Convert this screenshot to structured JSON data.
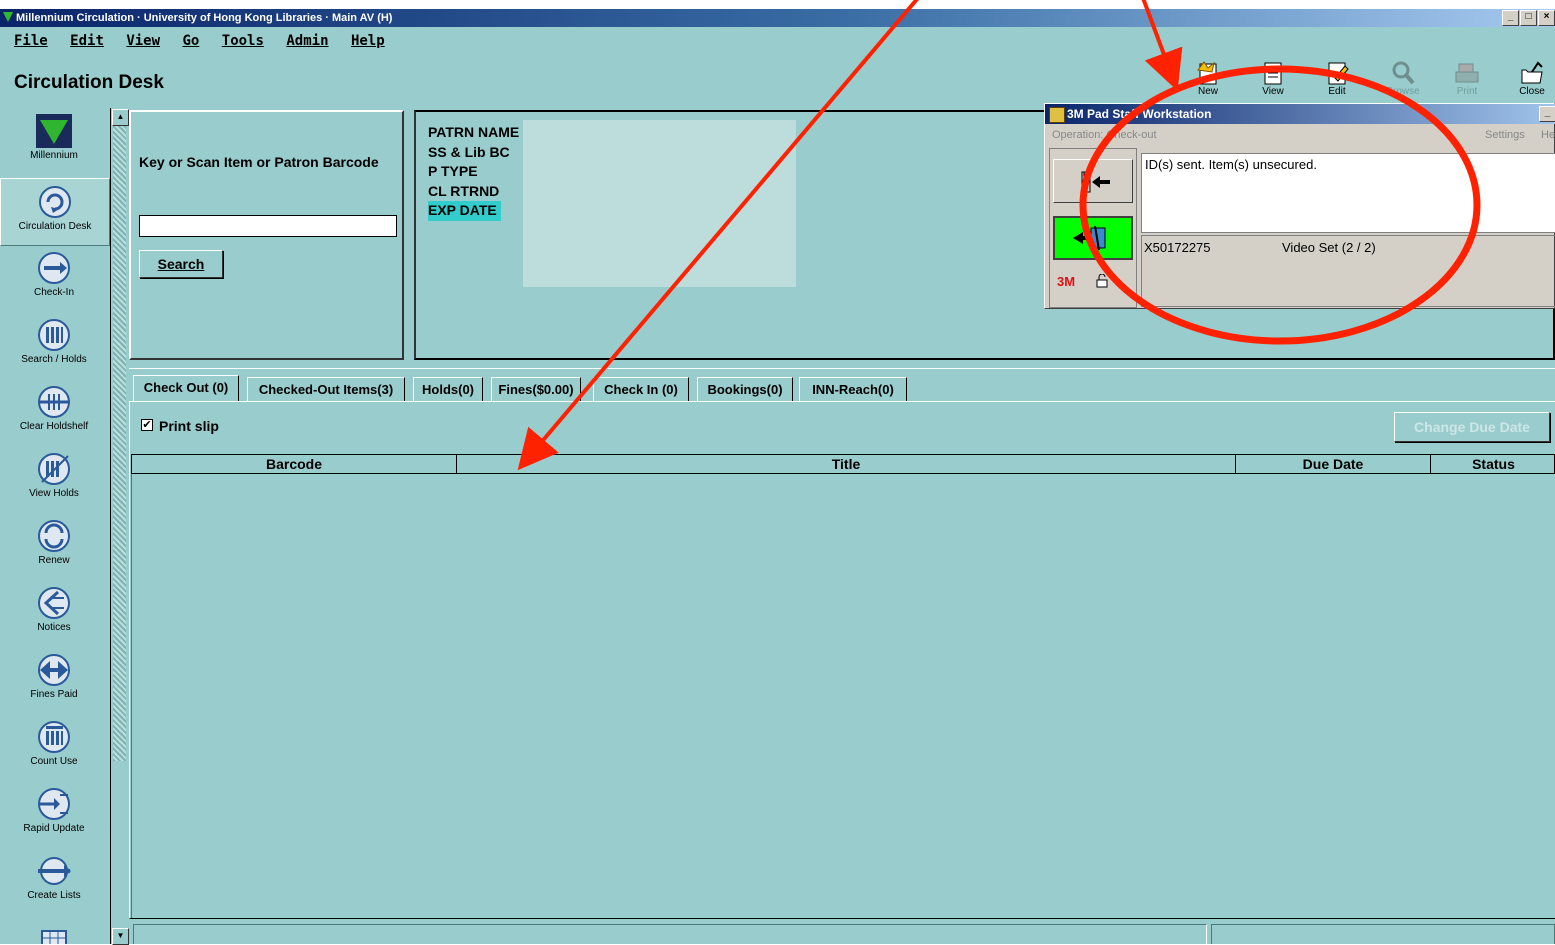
{
  "window": {
    "title": "Millennium Circulation · University of Hong Kong Libraries · Main AV (H)",
    "controls": [
      "_",
      "7",
      "×"
    ]
  },
  "menu": [
    "File",
    "Edit",
    "View",
    "Go",
    "Tools",
    "Admin",
    "Help"
  ],
  "page_title": "Circulation Desk",
  "toolbar": [
    {
      "label": "New",
      "icon": "new-icon",
      "enabled": true
    },
    {
      "label": "View",
      "icon": "view-icon",
      "enabled": true
    },
    {
      "label": "Edit",
      "icon": "edit-icon",
      "enabled": true
    },
    {
      "label": "Browse",
      "icon": "magnifier-icon",
      "enabled": false
    },
    {
      "label": "Print",
      "icon": "printer-icon",
      "enabled": false
    },
    {
      "label": "Close",
      "icon": "folder-open-icon",
      "enabled": true
    }
  ],
  "sidebar": {
    "items": [
      {
        "label": "Millennium",
        "icon": "millennium-logo-icon"
      },
      {
        "label": "Circulation Desk",
        "icon": "circulation-desk-icon",
        "selected": true
      },
      {
        "label": "Check-In",
        "icon": "check-in-icon"
      },
      {
        "label": "Search / Holds",
        "icon": "search-holds-icon"
      },
      {
        "label": "Clear Holdshelf",
        "icon": "clear-holdshelf-icon"
      },
      {
        "label": "View Holds",
        "icon": "view-holds-icon"
      },
      {
        "label": "Renew",
        "icon": "renew-icon"
      },
      {
        "label": "Notices",
        "icon": "notices-icon"
      },
      {
        "label": "Fines Paid",
        "icon": "fines-paid-icon"
      },
      {
        "label": "Count Use",
        "icon": "count-use-icon"
      },
      {
        "label": "Rapid Update",
        "icon": "rapid-update-icon"
      },
      {
        "label": "Create Lists",
        "icon": "create-lists-icon"
      }
    ]
  },
  "search": {
    "prompt": "Key or Scan Item or Patron Barcode",
    "value": "",
    "button": "Search"
  },
  "patron": {
    "fields": [
      "PATRN NAME",
      "SS & Lib BC",
      "P TYPE",
      "CL RTRND",
      "EXP DATE"
    ]
  },
  "tabs": [
    {
      "label": "Check Out (0)",
      "active": true
    },
    {
      "label": "Checked-Out Items(3)"
    },
    {
      "label": "Holds(0)"
    },
    {
      "label": "Fines($0.00)"
    },
    {
      "label": "Check In (0)"
    },
    {
      "label": "Bookings(0)"
    },
    {
      "label": "INN-Reach(0)"
    }
  ],
  "checkout": {
    "print_slip_label": "Print slip",
    "print_slip_checked": true,
    "change_due_date": "Change Due Date",
    "columns": [
      "Barcode",
      "Title",
      "Due Date",
      "Status"
    ]
  },
  "pad_window": {
    "title": "3M Pad Staff Workstation",
    "operation": "Operation: Check-out",
    "settings": "Settings",
    "help": "He",
    "message": "ID(s) sent. Item(s) unsecured.",
    "item_barcode": "X50172275",
    "item_title": "Video Set (2 / 2)",
    "brand": "3M"
  },
  "colors": {
    "background": "#99cccc",
    "title_bar": "#0a246a",
    "annotation": "#ff2200",
    "pad_active_button": "#00ff00"
  }
}
